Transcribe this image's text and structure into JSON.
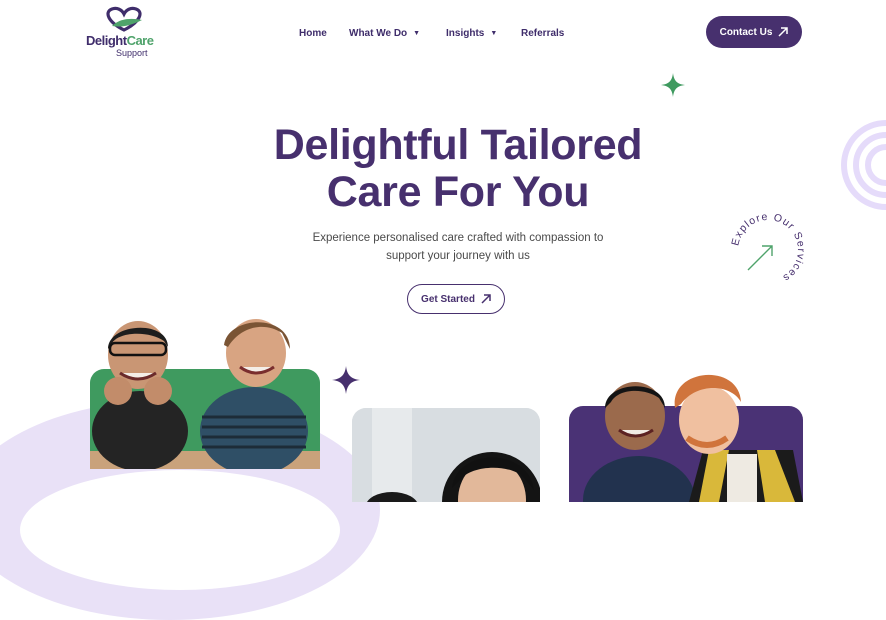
{
  "brand": {
    "name_part1": "Delight",
    "name_part2": "Care",
    "sub": "Support"
  },
  "nav": {
    "items": [
      {
        "label": "Home"
      },
      {
        "label": "What We Do",
        "dropdown": true
      },
      {
        "label": "Insights",
        "dropdown": true
      },
      {
        "label": "Referrals"
      }
    ],
    "contact_label": "Contact Us"
  },
  "hero": {
    "title_line1": "Delightful Tailored",
    "title_line2": "Care For You",
    "subtitle_line1": "Experience personalised care crafted with compassion to",
    "subtitle_line2": "support your journey with us",
    "cta_label": "Get Started"
  },
  "explore_badge": "Explore Our Services",
  "icons": [
    "logo-heart-leaf",
    "chevron-down-icon",
    "arrow-up-right-icon",
    "sparkle-icon",
    "concentric-rings",
    "arrow-up-right-icon"
  ],
  "colors": {
    "brand_purple": "#47306e",
    "brand_green": "#4fa36b",
    "lavender": "#e9e1f7"
  }
}
